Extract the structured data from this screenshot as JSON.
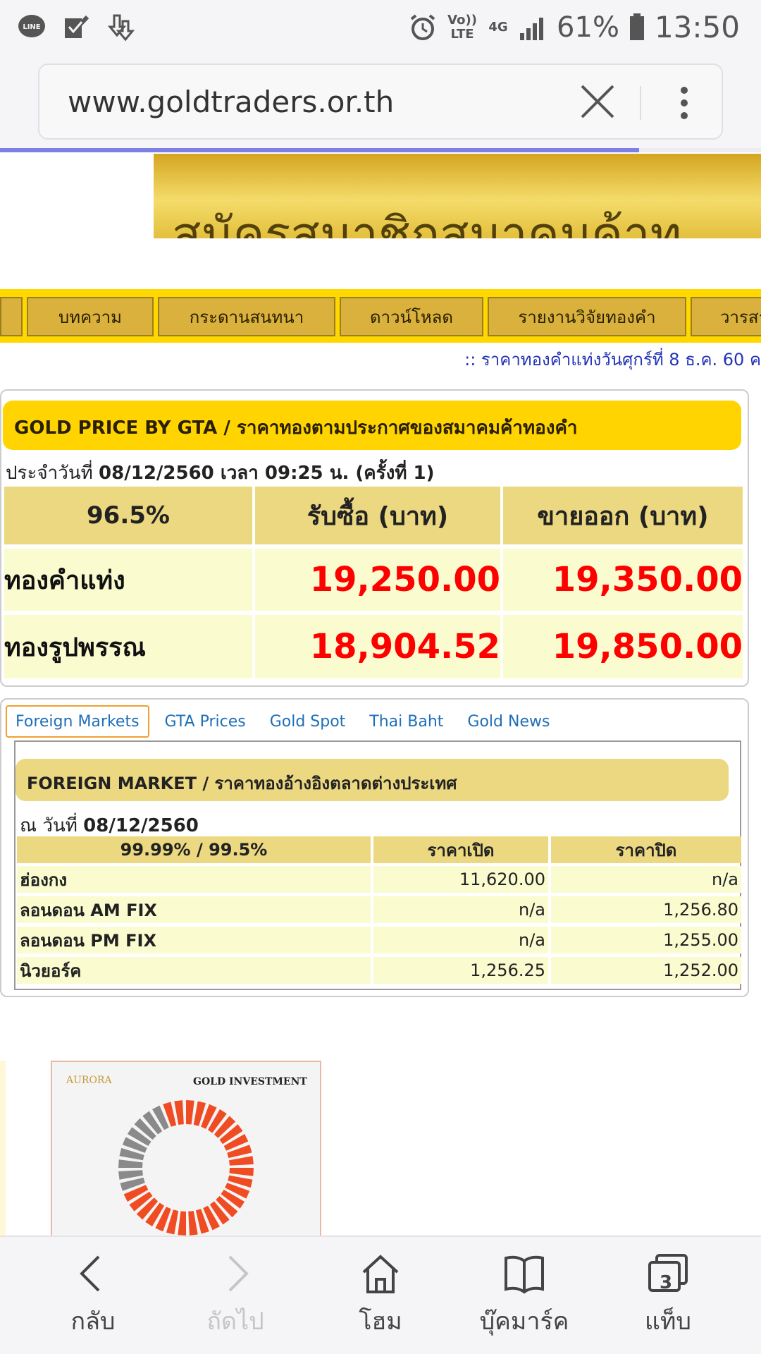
{
  "status_bar": {
    "time": "13:50",
    "battery_percent": "61%",
    "network_volte": "Vo)) LTE",
    "network_4g": "4G",
    "icons": [
      "line-icon",
      "check-icon",
      "download-icon",
      "alarm-icon",
      "signal-icon",
      "battery-icon"
    ]
  },
  "browser": {
    "url": "www.goldtraders.or.th",
    "load_progress": 0.84
  },
  "banner": {
    "text": "สมัครสมาชิกสมาคมค้าท"
  },
  "nav": {
    "items": [
      "บทความ",
      "กระดานสนทนา",
      "ดาวน์โหลด",
      "รายงานวิจัยทองคำ",
      "วารสา"
    ]
  },
  "marquee": ":: ราคาทองคำแท่งวันศุกร์ที่ 8 ธ.ค. 60 ค",
  "gta": {
    "title": "GOLD PRICE BY GTA / ราคาทองตามประกาศของสมาคมค้าทองคำ",
    "date_prefix": "ประจำวันที่",
    "date_value": "08/12/2560 เวลา 09:25 น. (ครั้งที่ 1)",
    "headers": [
      "96.5%",
      "รับซื้อ (บาท)",
      "ขายออก (บาท)"
    ],
    "rows": [
      {
        "label": "ทองคำแท่ง",
        "buy": "19,250.00",
        "sell": "19,350.00"
      },
      {
        "label": "ทองรูปพรรณ",
        "buy": "18,904.52",
        "sell": "19,850.00"
      }
    ]
  },
  "foreign": {
    "tabs": [
      "Foreign Markets",
      "GTA Prices",
      "Gold Spot",
      "Thai Baht",
      "Gold News"
    ],
    "title": "FOREIGN MARKET / ราคาทองอ้างอิงตลาดต่างประเทศ",
    "date_prefix": "ณ วันที่",
    "date_value": "08/12/2560",
    "headers": [
      "99.99% / 99.5%",
      "ราคาเปิด",
      "ราคาปิด"
    ],
    "rows": [
      {
        "label": "ฮ่องกง",
        "open": "11,620.00",
        "close": "n/a"
      },
      {
        "label": "ลอนดอน AM FIX",
        "open": "n/a",
        "close": "1,256.80"
      },
      {
        "label": "ลอนดอน PM FIX",
        "open": "n/a",
        "close": "1,255.00"
      },
      {
        "label": "นิวยอร์ค",
        "open": "1,256.25",
        "close": "1,252.00"
      }
    ]
  },
  "ad": {
    "brand": "AURORA",
    "title": "GOLD INVESTMENT"
  },
  "bottom_bar": {
    "back": "กลับ",
    "forward": "ถัดไป",
    "home": "โฮม",
    "bookmarks": "บุ๊คมาร์ค",
    "tabs": "แท็บ",
    "tab_count": "3"
  },
  "colors": {
    "gold_header": "#ffd400",
    "price_red": "#ff0000",
    "link_blue": "#1f6fb8",
    "nav_yellow": "#ffd800"
  }
}
